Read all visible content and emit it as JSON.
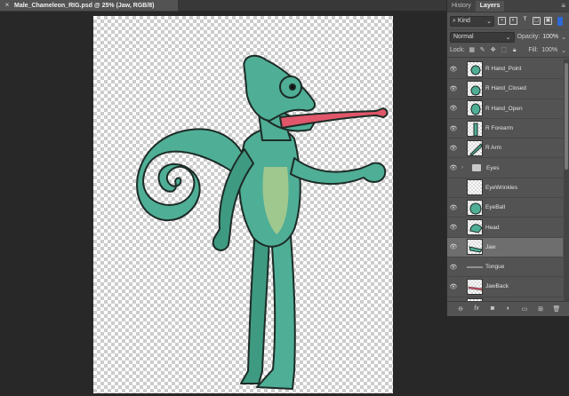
{
  "document": {
    "close_glyph": "×",
    "title": "Male_Chameleon_RIG.psd @ 25% (Jaw, RGB/8)"
  },
  "panel": {
    "tabs": [
      {
        "label": "History",
        "active": false
      },
      {
        "label": "Layers",
        "active": true
      }
    ],
    "menu_glyph": "≡",
    "filter": {
      "kind_label": "Kind",
      "icons": [
        "image-filter-icon",
        "adjustment-filter-icon",
        "type-filter-icon",
        "shape-filter-icon",
        "smart-object-filter-icon"
      ],
      "type_glyph": "T"
    },
    "blend_mode": "Normal",
    "opacity_label": "Opacity:",
    "opacity_value": "100%",
    "lock_label": "Lock:",
    "fill_label": "Fill:",
    "fill_value": "100%",
    "layers": [
      {
        "name": "R Hand_Point",
        "type": "layer",
        "visible": true,
        "selected": false
      },
      {
        "name": "R Hand_Closed",
        "type": "layer",
        "visible": true,
        "selected": false
      },
      {
        "name": "R Hand_Open",
        "type": "layer",
        "visible": true,
        "selected": false
      },
      {
        "name": "R Forearm",
        "type": "layer",
        "visible": true,
        "selected": false
      },
      {
        "name": "R Arm",
        "type": "layer",
        "visible": true,
        "selected": false
      },
      {
        "name": "Eyes",
        "type": "group",
        "visible": true,
        "selected": false
      },
      {
        "name": "EyeWrinkles",
        "type": "layer",
        "visible": false,
        "selected": false
      },
      {
        "name": "EyeBall",
        "type": "layer",
        "visible": true,
        "selected": false
      },
      {
        "name": "Head",
        "type": "layer",
        "visible": true,
        "selected": false
      },
      {
        "name": "Jaw",
        "type": "layer",
        "visible": true,
        "selected": true
      },
      {
        "name": "Tongue",
        "type": "layer",
        "visible": true,
        "selected": false
      },
      {
        "name": "JawBack",
        "type": "layer",
        "visible": true,
        "selected": false
      },
      {
        "name": "...",
        "type": "layer",
        "visible": true,
        "selected": false
      }
    ],
    "footer_icons": [
      "link-layers-icon",
      "fx-icon",
      "add-mask-icon",
      "adjustment-layer-icon",
      "new-group-icon",
      "new-layer-icon",
      "delete-layer-icon"
    ],
    "fx_label": "fx"
  },
  "colors": {
    "chameleon_skin": "#4fae96",
    "chameleon_shadow": "#2f7d6b",
    "belly": "#9fc88e",
    "tongue": "#e0566a",
    "selection": "#6e6e6e"
  }
}
